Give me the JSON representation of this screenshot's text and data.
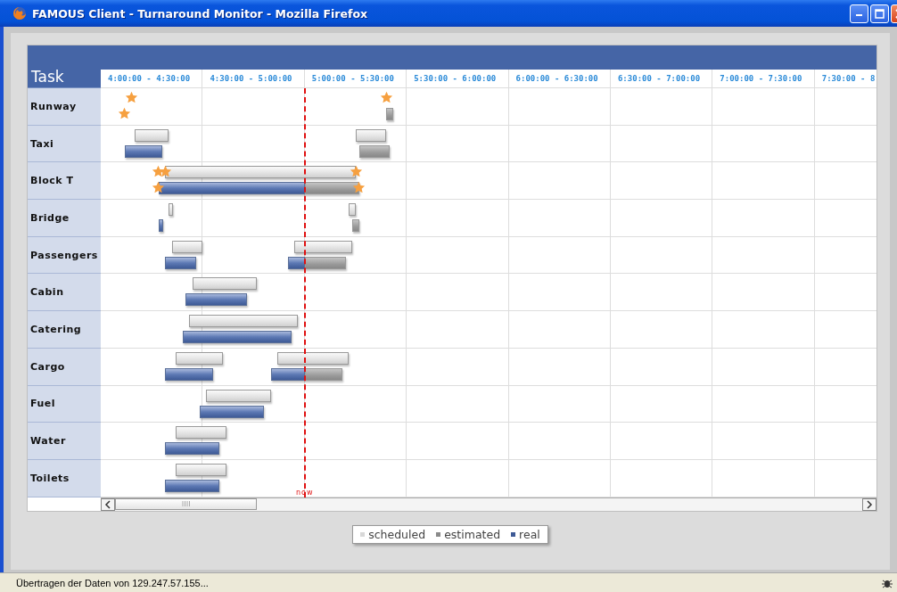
{
  "window": {
    "title": "FAMOUS Client - Turnaround Monitor - Mozilla Firefox"
  },
  "gantt": {
    "task_header": "Task",
    "now_label": "now",
    "columns": [
      "4:00:00 - 4:30:00",
      "4:30:00 - 5:00:00",
      "5:00:00 - 5:30:00",
      "5:30:00 - 6:00:00",
      "6:00:00 - 6:30:00",
      "6:30:00 - 7:00:00",
      "7:00:00 - 7:30:00",
      "7:30:00 - 8"
    ],
    "rows": [
      {
        "task": "Runway",
        "items": [
          {
            "kind": "milestone"
          },
          {
            "kind": "achieved"
          },
          {
            "kind": "milestone"
          },
          {
            "kind": "estimated"
          }
        ]
      },
      {
        "task": "Taxi",
        "items": [
          {
            "kind": "scheduled"
          },
          {
            "kind": "real"
          },
          {
            "kind": "scheduled"
          },
          {
            "kind": "estimated"
          }
        ]
      },
      {
        "task": "Block T",
        "items": [
          {
            "kind": "scheduled"
          },
          {
            "kind": "milestone"
          },
          {
            "kind": "milestone"
          },
          {
            "kind": "milestone"
          },
          {
            "kind": "real"
          },
          {
            "kind": "estimated"
          },
          {
            "kind": "achieved"
          },
          {
            "kind": "achieved"
          }
        ]
      },
      {
        "task": "Bridge",
        "items": [
          {
            "kind": "scheduled"
          },
          {
            "kind": "real"
          },
          {
            "kind": "scheduled"
          },
          {
            "kind": "estimated"
          }
        ]
      },
      {
        "task": "Passengers",
        "items": [
          {
            "kind": "scheduled"
          },
          {
            "kind": "real"
          },
          {
            "kind": "scheduled"
          },
          {
            "kind": "real"
          },
          {
            "kind": "estimated"
          }
        ]
      },
      {
        "task": "Cabin",
        "items": [
          {
            "kind": "scheduled"
          },
          {
            "kind": "real"
          }
        ]
      },
      {
        "task": "Catering",
        "items": [
          {
            "kind": "scheduled"
          },
          {
            "kind": "real"
          }
        ]
      },
      {
        "task": "Cargo",
        "items": [
          {
            "kind": "scheduled"
          },
          {
            "kind": "real"
          },
          {
            "kind": "scheduled"
          },
          {
            "kind": "real"
          },
          {
            "kind": "estimated"
          }
        ]
      },
      {
        "task": "Fuel",
        "items": [
          {
            "kind": "scheduled"
          },
          {
            "kind": "real"
          }
        ]
      },
      {
        "task": "Water",
        "items": [
          {
            "kind": "scheduled"
          },
          {
            "kind": "real"
          }
        ]
      },
      {
        "task": "Toilets",
        "items": [
          {
            "kind": "scheduled"
          },
          {
            "kind": "real"
          }
        ]
      }
    ]
  },
  "legend": [
    {
      "kind": "scheduled",
      "label": "scheduled"
    },
    {
      "kind": "estimated",
      "label": "estimated"
    },
    {
      "kind": "real",
      "label": "real"
    }
  ],
  "status_bar": {
    "text": "Übertragen der Daten von 129.247.57.155..."
  }
}
